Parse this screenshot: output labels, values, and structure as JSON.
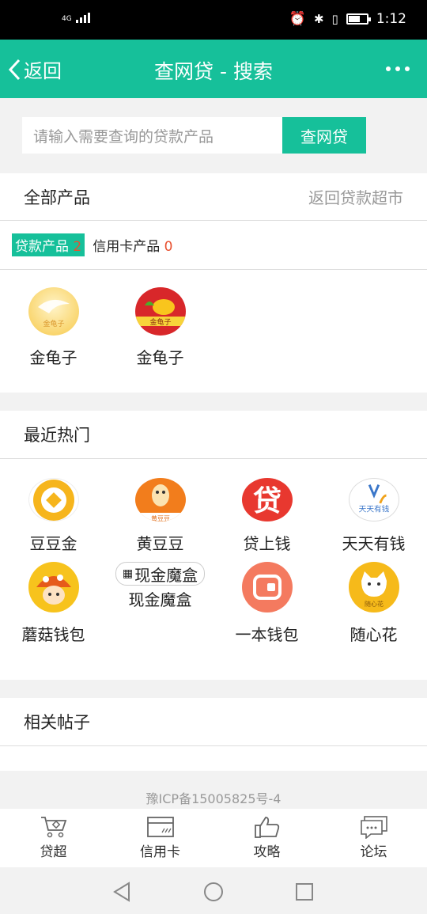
{
  "status_bar": {
    "network": "4G",
    "time": "1:12"
  },
  "nav": {
    "back_label": "返回",
    "title": "查网贷 - 搜索"
  },
  "search": {
    "placeholder": "请输入需要查询的贷款产品",
    "button": "查网贷"
  },
  "all_products": {
    "title": "全部产品",
    "link": "返回贷款超市",
    "filters": [
      {
        "label": "贷款产品",
        "count": "2"
      },
      {
        "label": "信用卡产品",
        "count": "0"
      }
    ],
    "items": [
      {
        "name": "金龟子",
        "icon": "gold-beetle-logo",
        "logo_text": "金龟子"
      },
      {
        "name": "金龟子",
        "icon": "gold-beetle-logo-alt",
        "logo_text": "金龟子"
      }
    ]
  },
  "hot": {
    "title": "最近热门",
    "items": [
      {
        "name": "豆豆金",
        "icon": "coin-logo"
      },
      {
        "name": "黄豆豆",
        "icon": "peanut-logo",
        "logo_text": "黄豆豆"
      },
      {
        "name": "贷上钱",
        "icon": "dai-char-logo",
        "logo_text": "贷"
      },
      {
        "name": "天天有钱",
        "icon": "tiantian-logo",
        "logo_text": "天天有钱"
      },
      {
        "name": "蘑菇钱包",
        "icon": "mushroom-logo"
      },
      {
        "name": "现金魔盒",
        "icon": "broken-image-icon",
        "alt": "现金魔盒"
      },
      {
        "name": "一本钱包",
        "icon": "wallet-logo"
      },
      {
        "name": "随心花",
        "icon": "cat-logo",
        "logo_text": "随心花"
      }
    ]
  },
  "posts": {
    "title": "相关帖子"
  },
  "icp": "豫ICP备15005825号-4",
  "tabbar": [
    {
      "label": "贷超",
      "icon": "cart-icon"
    },
    {
      "label": "信用卡",
      "icon": "credit-card-icon"
    },
    {
      "label": "攻略",
      "icon": "thumbs-up-icon"
    },
    {
      "label": "论坛",
      "icon": "chat-icon"
    }
  ],
  "colors": {
    "brand": "#16c09a",
    "count_red": "#e8502f"
  }
}
